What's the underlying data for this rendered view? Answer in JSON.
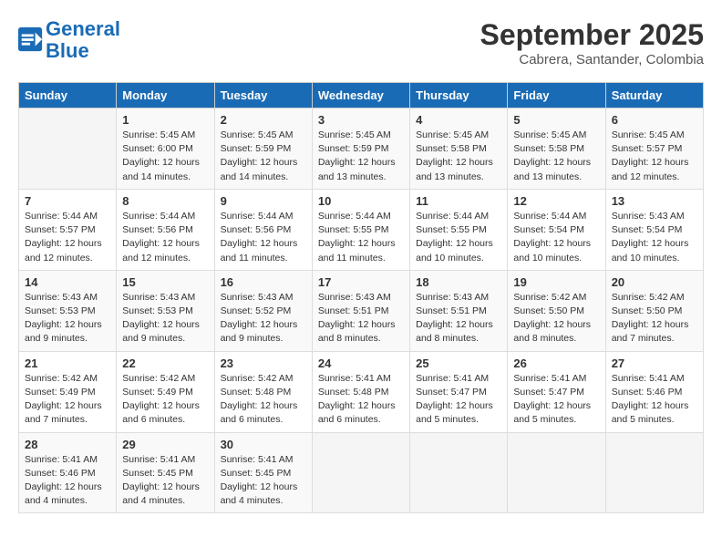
{
  "logo": {
    "line1": "General",
    "line2": "Blue"
  },
  "title": "September 2025",
  "subtitle": "Cabrera, Santander, Colombia",
  "days_of_week": [
    "Sunday",
    "Monday",
    "Tuesday",
    "Wednesday",
    "Thursday",
    "Friday",
    "Saturday"
  ],
  "weeks": [
    [
      {
        "day": "",
        "info": ""
      },
      {
        "day": "1",
        "info": "Sunrise: 5:45 AM\nSunset: 6:00 PM\nDaylight: 12 hours\nand 14 minutes."
      },
      {
        "day": "2",
        "info": "Sunrise: 5:45 AM\nSunset: 5:59 PM\nDaylight: 12 hours\nand 14 minutes."
      },
      {
        "day": "3",
        "info": "Sunrise: 5:45 AM\nSunset: 5:59 PM\nDaylight: 12 hours\nand 13 minutes."
      },
      {
        "day": "4",
        "info": "Sunrise: 5:45 AM\nSunset: 5:58 PM\nDaylight: 12 hours\nand 13 minutes."
      },
      {
        "day": "5",
        "info": "Sunrise: 5:45 AM\nSunset: 5:58 PM\nDaylight: 12 hours\nand 13 minutes."
      },
      {
        "day": "6",
        "info": "Sunrise: 5:45 AM\nSunset: 5:57 PM\nDaylight: 12 hours\nand 12 minutes."
      }
    ],
    [
      {
        "day": "7",
        "info": "Sunrise: 5:44 AM\nSunset: 5:57 PM\nDaylight: 12 hours\nand 12 minutes."
      },
      {
        "day": "8",
        "info": "Sunrise: 5:44 AM\nSunset: 5:56 PM\nDaylight: 12 hours\nand 12 minutes."
      },
      {
        "day": "9",
        "info": "Sunrise: 5:44 AM\nSunset: 5:56 PM\nDaylight: 12 hours\nand 11 minutes."
      },
      {
        "day": "10",
        "info": "Sunrise: 5:44 AM\nSunset: 5:55 PM\nDaylight: 12 hours\nand 11 minutes."
      },
      {
        "day": "11",
        "info": "Sunrise: 5:44 AM\nSunset: 5:55 PM\nDaylight: 12 hours\nand 10 minutes."
      },
      {
        "day": "12",
        "info": "Sunrise: 5:44 AM\nSunset: 5:54 PM\nDaylight: 12 hours\nand 10 minutes."
      },
      {
        "day": "13",
        "info": "Sunrise: 5:43 AM\nSunset: 5:54 PM\nDaylight: 12 hours\nand 10 minutes."
      }
    ],
    [
      {
        "day": "14",
        "info": "Sunrise: 5:43 AM\nSunset: 5:53 PM\nDaylight: 12 hours\nand 9 minutes."
      },
      {
        "day": "15",
        "info": "Sunrise: 5:43 AM\nSunset: 5:53 PM\nDaylight: 12 hours\nand 9 minutes."
      },
      {
        "day": "16",
        "info": "Sunrise: 5:43 AM\nSunset: 5:52 PM\nDaylight: 12 hours\nand 9 minutes."
      },
      {
        "day": "17",
        "info": "Sunrise: 5:43 AM\nSunset: 5:51 PM\nDaylight: 12 hours\nand 8 minutes."
      },
      {
        "day": "18",
        "info": "Sunrise: 5:43 AM\nSunset: 5:51 PM\nDaylight: 12 hours\nand 8 minutes."
      },
      {
        "day": "19",
        "info": "Sunrise: 5:42 AM\nSunset: 5:50 PM\nDaylight: 12 hours\nand 8 minutes."
      },
      {
        "day": "20",
        "info": "Sunrise: 5:42 AM\nSunset: 5:50 PM\nDaylight: 12 hours\nand 7 minutes."
      }
    ],
    [
      {
        "day": "21",
        "info": "Sunrise: 5:42 AM\nSunset: 5:49 PM\nDaylight: 12 hours\nand 7 minutes."
      },
      {
        "day": "22",
        "info": "Sunrise: 5:42 AM\nSunset: 5:49 PM\nDaylight: 12 hours\nand 6 minutes."
      },
      {
        "day": "23",
        "info": "Sunrise: 5:42 AM\nSunset: 5:48 PM\nDaylight: 12 hours\nand 6 minutes."
      },
      {
        "day": "24",
        "info": "Sunrise: 5:41 AM\nSunset: 5:48 PM\nDaylight: 12 hours\nand 6 minutes."
      },
      {
        "day": "25",
        "info": "Sunrise: 5:41 AM\nSunset: 5:47 PM\nDaylight: 12 hours\nand 5 minutes."
      },
      {
        "day": "26",
        "info": "Sunrise: 5:41 AM\nSunset: 5:47 PM\nDaylight: 12 hours\nand 5 minutes."
      },
      {
        "day": "27",
        "info": "Sunrise: 5:41 AM\nSunset: 5:46 PM\nDaylight: 12 hours\nand 5 minutes."
      }
    ],
    [
      {
        "day": "28",
        "info": "Sunrise: 5:41 AM\nSunset: 5:46 PM\nDaylight: 12 hours\nand 4 minutes."
      },
      {
        "day": "29",
        "info": "Sunrise: 5:41 AM\nSunset: 5:45 PM\nDaylight: 12 hours\nand 4 minutes."
      },
      {
        "day": "30",
        "info": "Sunrise: 5:41 AM\nSunset: 5:45 PM\nDaylight: 12 hours\nand 4 minutes."
      },
      {
        "day": "",
        "info": ""
      },
      {
        "day": "",
        "info": ""
      },
      {
        "day": "",
        "info": ""
      },
      {
        "day": "",
        "info": ""
      }
    ]
  ]
}
